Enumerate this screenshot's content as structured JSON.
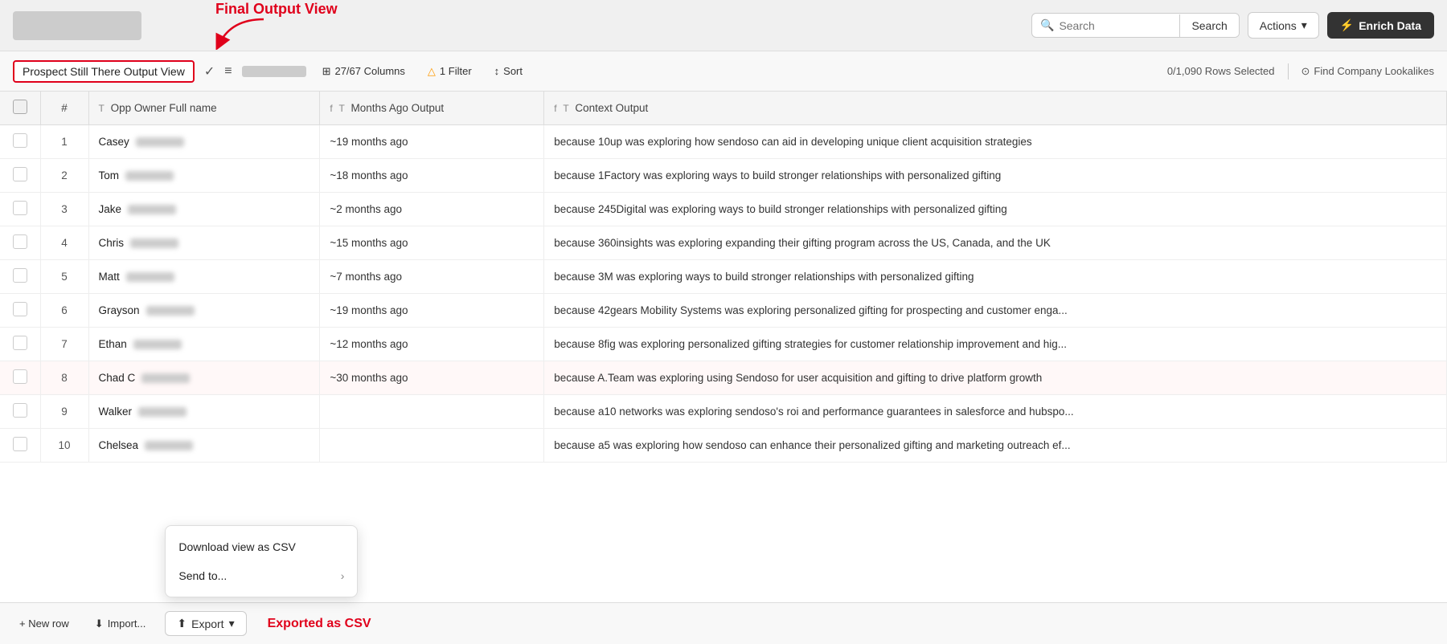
{
  "header": {
    "logo_placeholder": "",
    "annotation_label": "Final Output View",
    "search_placeholder": "Search",
    "search_button_label": "Search",
    "actions_label": "Actions",
    "enrich_label": "Enrich Data"
  },
  "subtoolbar": {
    "view_name": "Prospect Still There Output View",
    "columns_label": "27/67 Columns",
    "filter_label": "1 Filter",
    "sort_label": "Sort",
    "rows_selected": "0/1,090 Rows Selected",
    "find_lookalikes_label": "Find Company Lookalikes"
  },
  "table": {
    "columns": [
      "",
      "#",
      "Opp Owner Full name",
      "Months Ago Output",
      "Context Output"
    ],
    "col_types": [
      "",
      "",
      "T",
      "fT",
      "fT"
    ],
    "rows": [
      {
        "num": 1,
        "name": "Casey",
        "months": "~19 months ago",
        "context": "because 10up was exploring how sendoso can aid in developing unique client acquisition strategies"
      },
      {
        "num": 2,
        "name": "Tom",
        "months": "~18 months ago",
        "context": "because 1Factory was exploring ways to build stronger relationships with personalized gifting"
      },
      {
        "num": 3,
        "name": "Jake",
        "months": "~2 months ago",
        "context": "because 245Digital was exploring ways to build stronger relationships with personalized gifting"
      },
      {
        "num": 4,
        "name": "Chris",
        "months": "~15 months ago",
        "context": "because 360insights was exploring expanding their gifting program across the US, Canada, and the UK"
      },
      {
        "num": 5,
        "name": "Matt",
        "months": "~7 months ago",
        "context": "because 3M was exploring ways to build stronger relationships with personalized gifting"
      },
      {
        "num": 6,
        "name": "Grayson",
        "months": "~19 months ago",
        "context": "because 42gears Mobility Systems was exploring personalized gifting for prospecting and customer enga..."
      },
      {
        "num": 7,
        "name": "Ethan",
        "months": "~12 months ago",
        "context": "because 8fig was exploring personalized gifting strategies for customer relationship improvement and hig..."
      },
      {
        "num": 8,
        "name": "Chad C",
        "months": "~30 months ago",
        "context": "because A.Team was exploring using Sendoso for user acquisition and gifting to drive platform growth"
      },
      {
        "num": 9,
        "name": "Walker",
        "months": "",
        "context": "because a10 networks was exploring sendoso's roi and performance guarantees in salesforce and hubspo..."
      },
      {
        "num": 10,
        "name": "Chelsea",
        "months": "",
        "context": "because a5 was exploring how sendoso can enhance their personalized gifting and marketing outreach ef..."
      }
    ]
  },
  "bottom": {
    "new_row_label": "+ New row",
    "import_label": "Import...",
    "export_label": "Export",
    "export_annotation": "Exported as CSV"
  },
  "export_dropdown": {
    "items": [
      {
        "label": "Download view as CSV",
        "has_arrow": false
      },
      {
        "label": "Send to...",
        "has_arrow": true
      }
    ]
  },
  "icons": {
    "search": "🔍",
    "chevron_down": "▾",
    "columns_icon": "⊞",
    "filter_icon": "⊿",
    "sort_icon": "↕",
    "gear_icon": "⊙",
    "enrich_icon": "⚡",
    "upload_icon": "⬆",
    "new_row_icon": "+",
    "import_icon": "⬇",
    "lookalikes_icon": "⊙"
  }
}
